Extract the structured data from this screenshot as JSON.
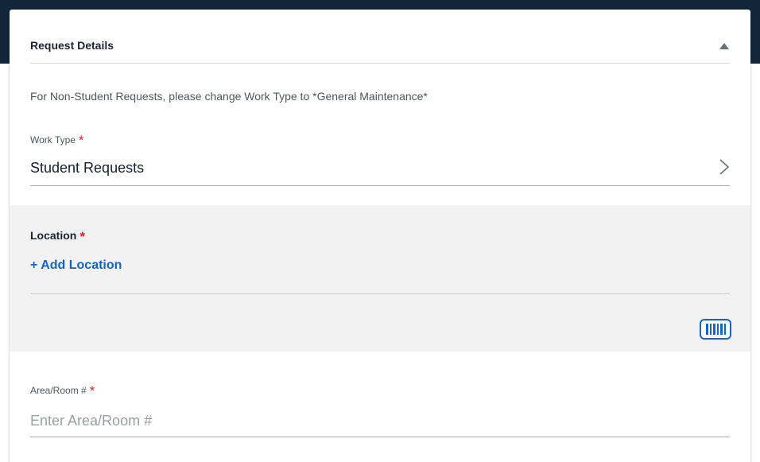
{
  "card": {
    "title": "Request Details",
    "collapse_icon": "triangle-up-icon"
  },
  "info_text": "For Non-Student Requests, please change Work Type to *General Maintenance*",
  "work_type": {
    "label": "Work Type",
    "required_mark": "*",
    "value": "Student Requests",
    "icon": "chevron-right-icon"
  },
  "location": {
    "label": "Location",
    "required_mark": "*",
    "add_label": "+ Add Location",
    "scan_icon": "barcode-icon"
  },
  "area_room": {
    "label": "Area/Room #",
    "required_mark": "*",
    "placeholder": "Enter Area/Room #",
    "value": ""
  },
  "colors": {
    "header_band": "#12263a",
    "link_blue": "#1565c0",
    "required_red": "#d8262d",
    "panel_gray": "#f2f2f2"
  }
}
